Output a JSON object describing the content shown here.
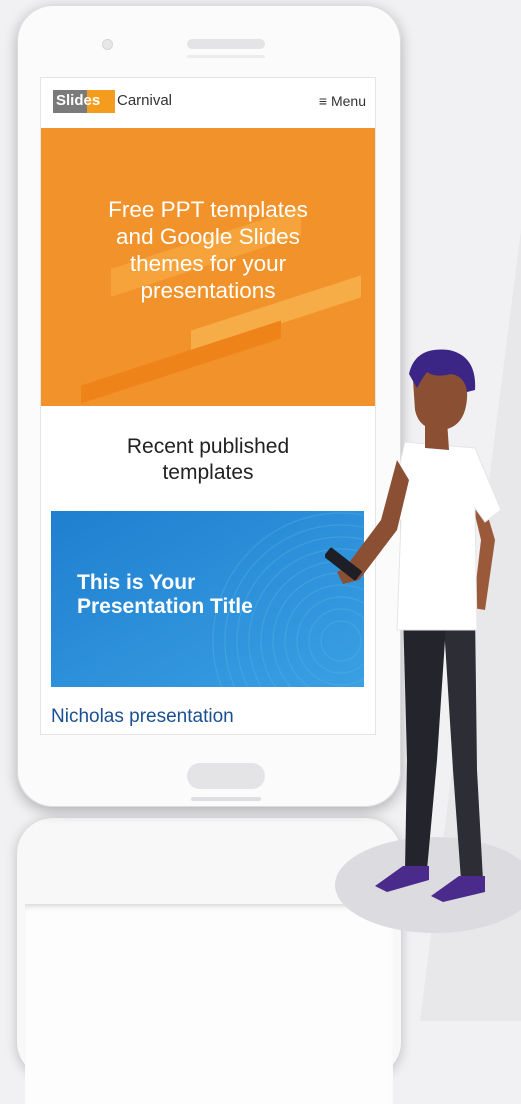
{
  "logo": {
    "part1": "Slides",
    "part2": "Carnival"
  },
  "nav": {
    "menu_label": "≡ Menu"
  },
  "hero": {
    "title_lines": [
      "Free PPT templates",
      "and Google Slides",
      "themes for your",
      "presentations"
    ]
  },
  "section": {
    "title_lines": [
      "Recent published",
      "templates"
    ]
  },
  "card": {
    "title_lines": [
      "This is Your",
      "Presentation Title"
    ],
    "name": "Nicholas presentation"
  },
  "colors": {
    "hero_orange": "#f2922a",
    "brand_orange": "#f39c1d",
    "card_blue": "#2d8ad6",
    "link_blue": "#1a4f93"
  }
}
